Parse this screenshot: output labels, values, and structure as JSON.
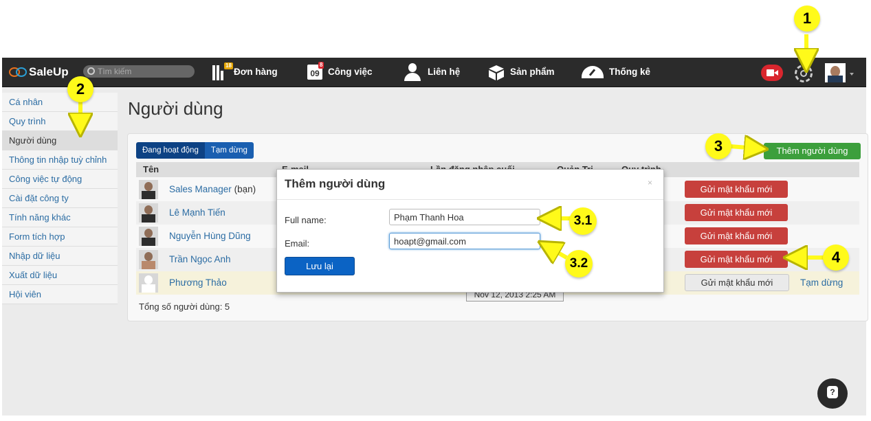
{
  "app": {
    "name": "SaleUp"
  },
  "nav": {
    "search_placeholder": "Tìm kiếm",
    "orders": {
      "label": "Đơn hàng",
      "badge": "18"
    },
    "tasks": {
      "label": "Công việc",
      "badge": "8",
      "day": "09"
    },
    "contacts": {
      "label": "Liên hệ"
    },
    "products": {
      "label": "Sản phẩm"
    },
    "stats": {
      "label": "Thống kê"
    }
  },
  "sidebar": {
    "items": [
      {
        "label": "Cá nhân"
      },
      {
        "label": "Quy trình"
      },
      {
        "label": "Người dùng"
      },
      {
        "label": "Thông tin nhập tuỳ chỉnh"
      },
      {
        "label": "Công việc tự động"
      },
      {
        "label": "Cài đặt công ty"
      },
      {
        "label": "Tính năng khác"
      },
      {
        "label": "Form tích hợp"
      },
      {
        "label": "Nhập dữ liệu"
      },
      {
        "label": "Xuất dữ liệu"
      },
      {
        "label": "Hội viên"
      }
    ]
  },
  "page": {
    "title": "Người dùng"
  },
  "tabs": {
    "active": "Đang hoạt động",
    "inactive": "Tạm dừng"
  },
  "add_user_label": "Thêm người dùng",
  "table": {
    "headers": {
      "name": "Tên",
      "email": "E-mail",
      "last_login": "Lần đăng nhập cuối",
      "admin": "Quản Trị",
      "process": "Quy trình"
    },
    "rows": [
      {
        "name": "Sales Manager",
        "suffix": "(bạn)",
        "action": "Gửi mật khẩu mới"
      },
      {
        "name": "Lê Mạnh Tiến",
        "action": "Gửi mật khẩu mới"
      },
      {
        "name": "Nguyễn Hùng Dũng",
        "action": "Gửi mật khẩu mới"
      },
      {
        "name": "Trần Ngọc Anh",
        "action": "Gửi mật khẩu mới"
      },
      {
        "name": "Phương Thảo",
        "action": "Gửi mật khẩu mới",
        "status_link": "Tạm dừng"
      }
    ],
    "total": "Tổng số người dùng: 5"
  },
  "tooltip": "Nov 12, 2013 2:25 AM",
  "modal": {
    "title": "Thêm người dùng",
    "close": "×",
    "fullname_label": "Full name:",
    "fullname_value": "Phạm Thanh Hoa",
    "email_label": "Email:",
    "email_value": "hoapt@gmail.com",
    "save_label": "Lưu lại"
  },
  "callouts": [
    "1",
    "2",
    "3",
    "3.1",
    "3.2",
    "4"
  ],
  "colors": {
    "callout": "#fffa1a",
    "nav_bg": "#2b2b2b",
    "danger": "#c7403c",
    "success": "#3c9f3c",
    "primary": "#0b63c4"
  }
}
